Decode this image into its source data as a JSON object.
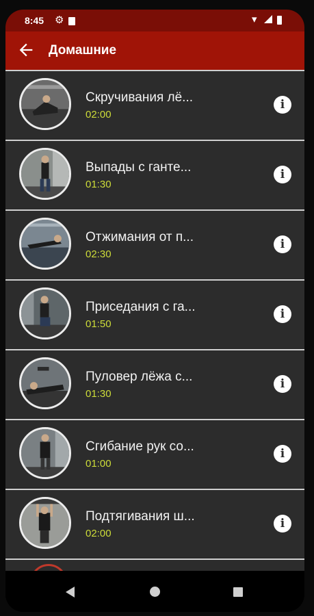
{
  "status": {
    "time": "8:45"
  },
  "appbar": {
    "title": "Домашние"
  },
  "exercises": [
    {
      "name": "Скручивания лё...",
      "duration": "02:00"
    },
    {
      "name": "Выпады с ганте...",
      "duration": "01:30"
    },
    {
      "name": "Отжимания от п...",
      "duration": "02:30"
    },
    {
      "name": "Приседания с га...",
      "duration": "01:50"
    },
    {
      "name": "Пуловер лёжа с...",
      "duration": "01:30"
    },
    {
      "name": "Сгибание рук со...",
      "duration": "01:00"
    },
    {
      "name": "Подтягивания ш...",
      "duration": "02:00"
    }
  ],
  "colors": {
    "appbar": "#a01407",
    "statusbar": "#7a0e06",
    "row_bg": "#2c2c2c",
    "duration_text": "#cddc39"
  },
  "icons": {
    "back": "arrow-left-icon",
    "info": "info-icon",
    "settings": "gear-icon",
    "wifi": "wifi-icon",
    "signal": "signal-icon",
    "battery": "battery-icon"
  }
}
